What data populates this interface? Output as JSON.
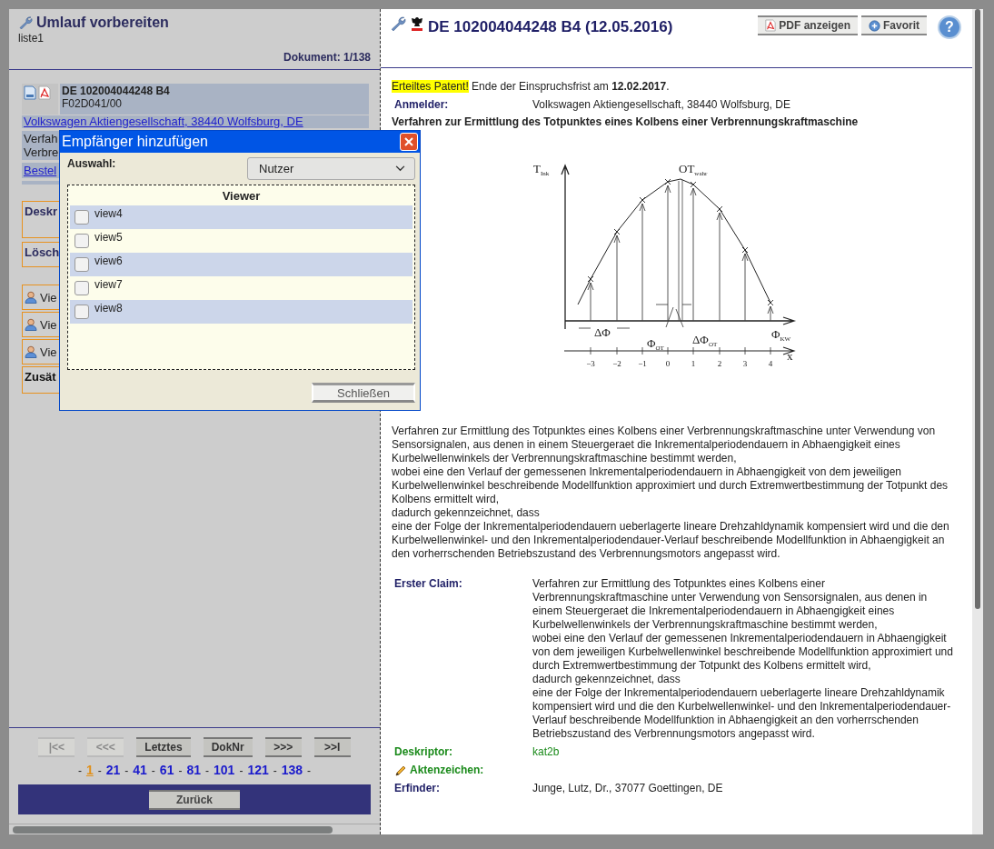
{
  "left_panel": {
    "title": "Umlauf vorbereiten",
    "subtitle": "liste1",
    "document_counter": "Dokument: 1/138",
    "document_card": {
      "number": "DE 102004044248 B4",
      "classification": "F02D041/00",
      "applicant_link": "Volkswagen Aktiengesellschaft, 38440 Wolfsburg, DE",
      "title_lines": [
        "Verfah",
        "Verbre"
      ],
      "order_link": "Bestel"
    },
    "sections": [
      {
        "kind": "heading",
        "label": "Deskr"
      },
      {
        "kind": "heading",
        "label": "Lösch"
      },
      {
        "kind": "user",
        "label": "Vie"
      },
      {
        "kind": "user",
        "label": "Vie"
      },
      {
        "kind": "user",
        "label": "Vie"
      },
      {
        "kind": "extra",
        "label": "Zusät"
      }
    ],
    "nav_buttons": [
      {
        "label": "|<<",
        "disabled": true
      },
      {
        "label": "<<<",
        "disabled": true
      },
      {
        "label": "Letztes",
        "disabled": false
      },
      {
        "label": "DokNr",
        "disabled": false
      },
      {
        "label": ">>>",
        "disabled": false
      },
      {
        "label": ">>I",
        "disabled": false
      }
    ],
    "pages": [
      {
        "label": "1",
        "selected": true
      },
      {
        "label": "21",
        "selected": false
      },
      {
        "label": "41",
        "selected": false
      },
      {
        "label": "61",
        "selected": false
      },
      {
        "label": "81",
        "selected": false
      },
      {
        "label": "101",
        "selected": false
      },
      {
        "label": "121",
        "selected": false
      },
      {
        "label": "138",
        "selected": false
      }
    ],
    "page_separator": "-",
    "back_button": "Zurück"
  },
  "dialog": {
    "title": "Empfänger hinzufügen",
    "selection_label": "Auswahl:",
    "selection_value": "Nutzer",
    "list_header": "Viewer",
    "recipients": [
      {
        "name": "view4",
        "checked": false
      },
      {
        "name": "view5",
        "checked": false
      },
      {
        "name": "view6",
        "checked": false
      },
      {
        "name": "view7",
        "checked": false
      },
      {
        "name": "view8",
        "checked": false
      }
    ],
    "close_button": "Schließen"
  },
  "right_panel": {
    "title": "DE 102004044248 B4 (12.05.2016)",
    "pdf_button": "PDF anzeigen",
    "favorite_button": "Favorit",
    "help_button": "?",
    "status_badge": "Erteiltes Patent!",
    "status_text": " Ende der Einspruchsfrist am **12.02.2017**.",
    "applicant": {
      "label": "Anmelder:",
      "value": "Volkswagen Aktiengesellschaft, 38440 Wolfsburg, DE",
      "color": "#1f1f66"
    },
    "patent_title": "Verfahren zur Ermittlung des Totpunktes eines Kolbens einer Verbrennungskraftmaschine",
    "figure": {
      "labels": [
        {
          "main": "T",
          "sub": "Ink"
        },
        {
          "main": "OT",
          "sub": "wahr"
        },
        {
          "main": "ΔΦ"
        },
        {
          "main": "Φ",
          "sub": "OT"
        },
        {
          "main": "ΔΦ",
          "sub": "OT"
        },
        {
          "main": "Φ",
          "sub": "KW"
        },
        {
          "main": "x"
        }
      ],
      "ticks": [
        "−3",
        "−2",
        "−1",
        "0",
        "1",
        "2",
        "3",
        "4"
      ]
    },
    "abstract": [
      "Verfahren zur Ermittlung des Totpunktes eines Kolbens einer Verbrennungskraftmaschine unter Verwendung von Sensorsignalen, aus denen in einem Steuergeraet die Inkrementalperiodendauern in Abhaengigkeit eines Kurbelwellenwinkels der Verbrennungskraftmaschine bestimmt werden,",
      "wobei eine den Verlauf der gemessenen Inkrementalperiodendauern in Abhaengigkeit von dem jeweiligen Kurbelwellenwinkel beschreibende Modellfunktion approximiert und durch Extremwertbestimmung der Totpunkt des Kolbens ermittelt wird,",
      "dadurch gekennzeichnet, dass",
      "eine der Folge der Inkrementalperiodendauern ueberlagerte lineare Drehzahldynamik kompensiert wird und die den Kurbelwellenwinkel- und den Inkrementalperiodendauer-Verlauf beschreibende Modellfunktion in Abhaengigkeit an den vorherrschenden Betriebszustand des Verbrennungsmotors angepasst wird."
    ],
    "fields": [
      {
        "kind": "text",
        "label": "Erster Claim:",
        "color": "#1f1f66",
        "lines": [
          "Verfahren zur Ermittlung des Totpunktes eines Kolbens einer Verbrennungskraftmaschine unter Verwendung von Sensorsignalen, aus denen in einem Steuergeraet die Inkrementalperiodendauern in Abhaengigkeit eines Kurbelwellenwinkels der Verbrennungskraftmaschine bestimmt werden,",
          "wobei eine den Verlauf der gemessenen Inkrementalperiodendauern in Abhaengigkeit von dem jeweiligen Kurbelwellenwinkel beschreibende Modellfunktion approximiert und durch Extremwertbestimmung der Totpunkt des Kolbens ermittelt wird,",
          "dadurch gekennzeichnet, dass",
          "eine der Folge der Inkrementalperiodendauern ueberlagerte lineare Drehzahldynamik kompensiert wird und die den Kurbelwellenwinkel- und den Inkrementalperiodendauer-Verlauf beschreibende Modellfunktion in Abhaengigkeit an den vorherrschenden Betriebszustand des Verbrennungsmotors angepasst wird."
        ]
      },
      {
        "kind": "descriptor",
        "label": "Deskriptor:",
        "color": "#1a8a1a",
        "lines": [
          "kat2b"
        ]
      },
      {
        "kind": "editable",
        "label": "Aktenzeichen:",
        "color": "#1a8a1a"
      },
      {
        "kind": "text",
        "label": "Erfinder:",
        "color": "#1f1f66",
        "lines": [
          "Junge, Lutz, Dr., 37077 Goettingen, DE"
        ]
      }
    ]
  }
}
